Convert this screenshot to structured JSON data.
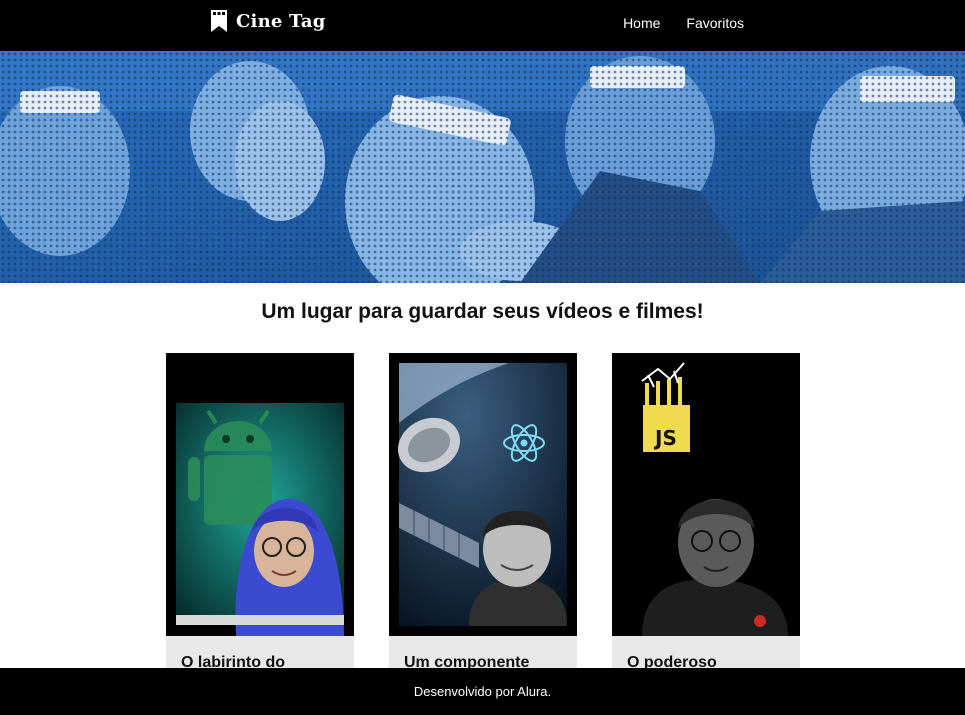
{
  "header": {
    "logo_text": "Cine Tag",
    "logo_icon": "film-bookmark-icon",
    "nav": [
      {
        "label": "Home"
      },
      {
        "label": "Favoritos"
      }
    ]
  },
  "banner": {
    "accent_color": "#2f77c8"
  },
  "main": {
    "title": "Um lugar para guardar seus vídeos e filmes!"
  },
  "cards": [
    {
      "title": "O labirinto do",
      "theme": "android",
      "accent": "#1a8f86"
    },
    {
      "title": "Um componente",
      "theme": "react",
      "accent": "#61dafb"
    },
    {
      "title": "O poderoso",
      "theme": "javascript",
      "accent": "#f0db4f"
    }
  ],
  "footer": {
    "text": "Desenvolvido por Alura."
  }
}
